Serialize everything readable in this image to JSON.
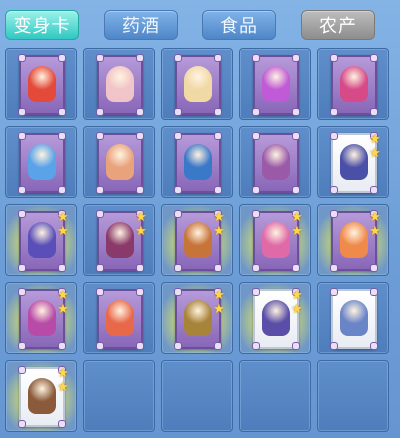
{
  "tabs": [
    {
      "label": "变身卡",
      "state": "active"
    },
    {
      "label": "药酒",
      "state": "normal"
    },
    {
      "label": "食品",
      "state": "normal"
    },
    {
      "label": "农产",
      "state": "gray"
    }
  ],
  "inventory": {
    "columns": 5,
    "slots": [
      {
        "card": "purple",
        "stars": 0,
        "glow": false,
        "figure_color": "#e44a3a"
      },
      {
        "card": "purple",
        "stars": 0,
        "glow": false,
        "figure_color": "#f0c4c8"
      },
      {
        "card": "purple",
        "stars": 0,
        "glow": false,
        "figure_color": "#f1d9a6"
      },
      {
        "card": "purple",
        "stars": 0,
        "glow": false,
        "figure_color": "#c05ad6"
      },
      {
        "card": "purple",
        "stars": 0,
        "glow": false,
        "figure_color": "#d64a88"
      },
      {
        "card": "purple",
        "stars": 0,
        "glow": false,
        "figure_color": "#5aa3e8"
      },
      {
        "card": "purple",
        "stars": 0,
        "glow": false,
        "figure_color": "#e8a37d"
      },
      {
        "card": "purple",
        "stars": 0,
        "glow": false,
        "figure_color": "#3a78c8"
      },
      {
        "card": "purple",
        "stars": 0,
        "glow": false,
        "figure_color": "#9a5aa8"
      },
      {
        "card": "white",
        "stars": 2,
        "glow": false,
        "figure_color": "#4a4fa8"
      },
      {
        "card": "purple",
        "stars": 2,
        "glow": true,
        "figure_color": "#5a4fb8"
      },
      {
        "card": "purple",
        "stars": 2,
        "glow": false,
        "figure_color": "#8a3a6a"
      },
      {
        "card": "purple",
        "stars": 2,
        "glow": true,
        "figure_color": "#c7743a"
      },
      {
        "card": "purple",
        "stars": 2,
        "glow": true,
        "figure_color": "#e06aa8"
      },
      {
        "card": "purple",
        "stars": 2,
        "glow": true,
        "figure_color": "#f08a4a"
      },
      {
        "card": "purple",
        "stars": 2,
        "glow": true,
        "figure_color": "#b84aa8"
      },
      {
        "card": "purple",
        "stars": 0,
        "glow": false,
        "figure_color": "#e8684a"
      },
      {
        "card": "purple",
        "stars": 2,
        "glow": true,
        "figure_color": "#a8843a"
      },
      {
        "card": "white",
        "stars": 2,
        "glow": true,
        "figure_color": "#5a4fa8"
      },
      {
        "card": "white",
        "stars": 0,
        "glow": false,
        "figure_color": "#6a84c8"
      },
      {
        "card": "white",
        "stars": 2,
        "glow": true,
        "figure_color": "#8a5a3a"
      },
      {
        "card": null,
        "stars": 0,
        "glow": false
      },
      {
        "card": null,
        "stars": 0,
        "glow": false
      },
      {
        "card": null,
        "stars": 0,
        "glow": false
      },
      {
        "card": null,
        "stars": 0,
        "glow": false
      }
    ]
  },
  "star_glyph": "★"
}
